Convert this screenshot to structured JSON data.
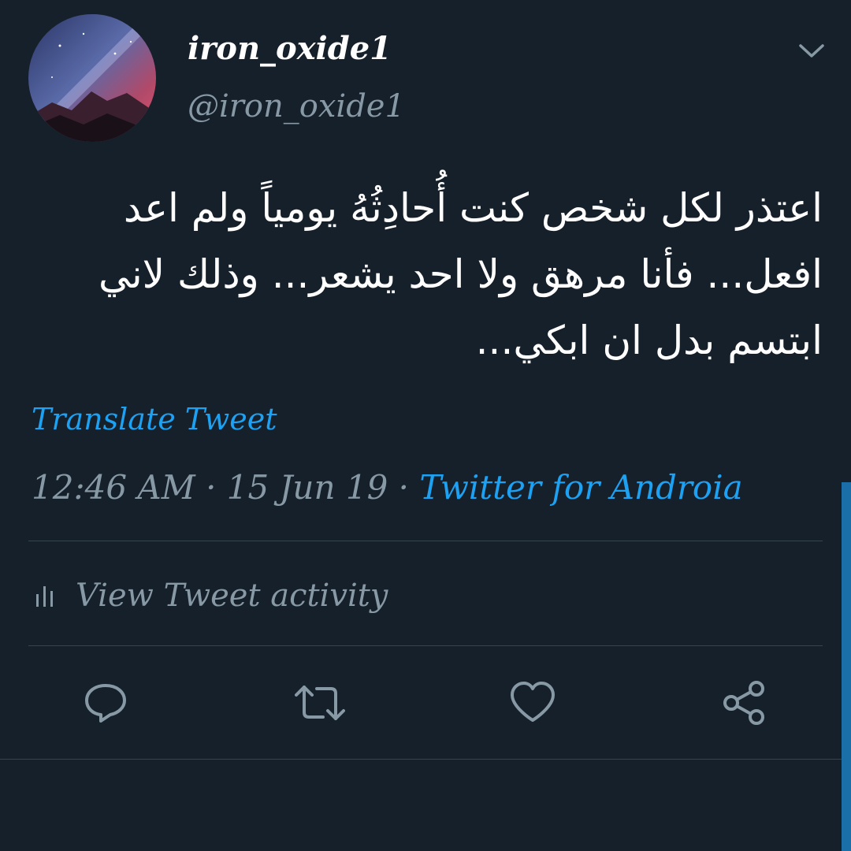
{
  "user": {
    "display_name": "iron_oxide1",
    "handle": "@iron_oxide1",
    "avatar_icon": "galaxy-mountain-avatar"
  },
  "tweet": {
    "text": "اعتذر لكل شخص كنت أُحادِثُهُ يومياً ولم اعد افعل... فأنا مرهق ولا احد يشعر... وذلك لاني ابتسم بدل ان ابكي...",
    "translate_label": "Translate Tweet",
    "time": "12:46 AM",
    "date": "15 Jun 19",
    "separator": " · ",
    "source": "Twitter for Androia"
  },
  "activity": {
    "label": "View Tweet activity",
    "icon": "bar-chart-icon"
  },
  "actions": [
    {
      "name": "reply",
      "icon": "reply-icon"
    },
    {
      "name": "retweet",
      "icon": "retweet-icon"
    },
    {
      "name": "like",
      "icon": "heart-icon"
    },
    {
      "name": "share",
      "icon": "share-icon"
    }
  ],
  "colors": {
    "background": "#16202b",
    "link": "#1da1f2",
    "muted": "#8899a6",
    "divider": "#38444d",
    "text": "#ffffff"
  }
}
